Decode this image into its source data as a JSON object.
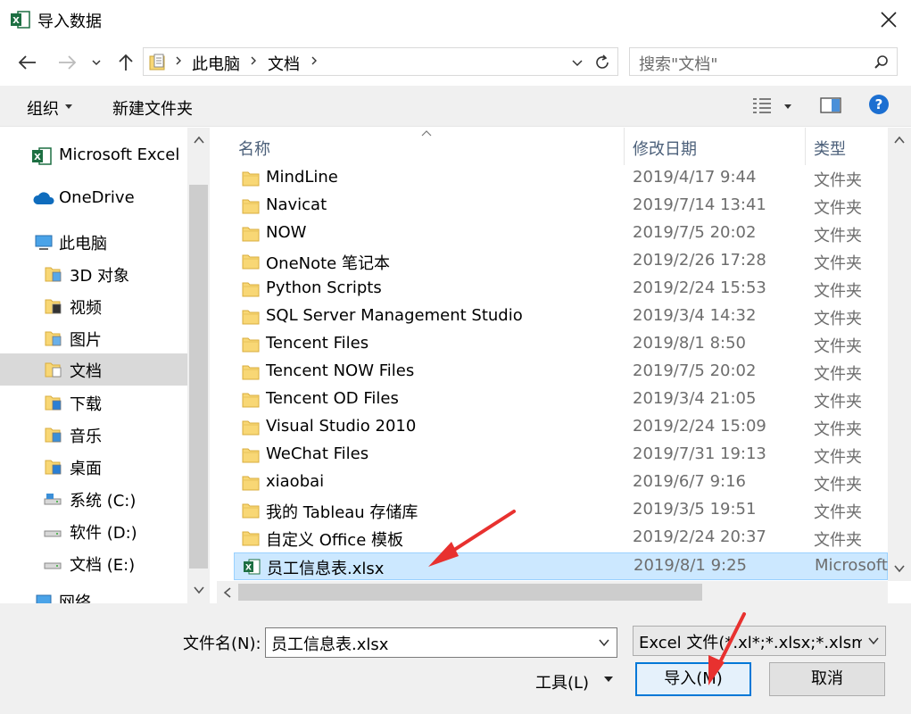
{
  "window": {
    "title": "导入数据"
  },
  "breadcrumb": [
    "此电脑",
    "文档"
  ],
  "search": {
    "placeholder": "搜索\"文档\""
  },
  "toolbar": {
    "organize": "组织",
    "new_folder": "新建文件夹"
  },
  "nav": [
    {
      "label": "Microsoft Excel",
      "icon": "excel-icon"
    },
    {
      "label": "OneDrive",
      "icon": "cloud-icon"
    },
    {
      "label": "此电脑",
      "icon": "computer-icon"
    },
    {
      "label": "3D 对象",
      "icon": "3d-objects-icon"
    },
    {
      "label": "视频",
      "icon": "video-folder-icon"
    },
    {
      "label": "图片",
      "icon": "pictures-folder-icon"
    },
    {
      "label": "文档",
      "icon": "documents-folder-icon"
    },
    {
      "label": "下载",
      "icon": "downloads-folder-icon"
    },
    {
      "label": "音乐",
      "icon": "music-folder-icon"
    },
    {
      "label": "桌面",
      "icon": "desktop-folder-icon"
    },
    {
      "label": "系统 (C:)",
      "icon": "system-drive-icon"
    },
    {
      "label": "软件 (D:)",
      "icon": "drive-icon"
    },
    {
      "label": "文档 (E:)",
      "icon": "drive-icon"
    },
    {
      "label": "网络",
      "icon": "network-icon"
    }
  ],
  "columns": {
    "name": "名称",
    "modified": "修改日期",
    "type": "类型"
  },
  "files": [
    {
      "name": "MindLine",
      "date": "2019/4/17 9:44",
      "type": "文件夹"
    },
    {
      "name": "Navicat",
      "date": "2019/7/14 13:41",
      "type": "文件夹"
    },
    {
      "name": "NOW",
      "date": "2019/7/5 20:02",
      "type": "文件夹"
    },
    {
      "name": "OneNote 笔记本",
      "date": "2019/2/26 17:28",
      "type": "文件夹"
    },
    {
      "name": "Python Scripts",
      "date": "2019/2/24 15:53",
      "type": "文件夹"
    },
    {
      "name": "SQL Server Management Studio",
      "date": "2019/3/4 14:32",
      "type": "文件夹"
    },
    {
      "name": "Tencent Files",
      "date": "2019/8/1 8:50",
      "type": "文件夹"
    },
    {
      "name": "Tencent NOW Files",
      "date": "2019/7/5 20:02",
      "type": "文件夹"
    },
    {
      "name": "Tencent OD Files",
      "date": "2019/3/4 21:05",
      "type": "文件夹"
    },
    {
      "name": "Visual Studio 2010",
      "date": "2019/2/24 15:09",
      "type": "文件夹"
    },
    {
      "name": "WeChat Files",
      "date": "2019/7/31 19:13",
      "type": "文件夹"
    },
    {
      "name": "xiaobai",
      "date": "2019/6/7 9:16",
      "type": "文件夹"
    },
    {
      "name": "我的 Tableau 存储库",
      "date": "2019/3/5 19:51",
      "type": "文件夹"
    },
    {
      "name": "自定义 Office 模板",
      "date": "2019/2/24 20:37",
      "type": "文件夹"
    },
    {
      "name": "员工信息表.xlsx",
      "date": "2019/8/1 9:25",
      "type": "Microsoft"
    }
  ],
  "filename": {
    "label": "文件名(N):",
    "value": "员工信息表.xlsx"
  },
  "filetype": {
    "value": "Excel 文件(*.xl*;*.xlsx;*.xlsm;*.x"
  },
  "buttons": {
    "tools": "工具(L)",
    "import": "导入(M)",
    "cancel": "取消"
  },
  "colors": {
    "accent": "#0078d7",
    "selection": "#cce8ff",
    "folder": "#f8d775",
    "excel": "#1d6f42",
    "arrow": "#e8312f"
  }
}
